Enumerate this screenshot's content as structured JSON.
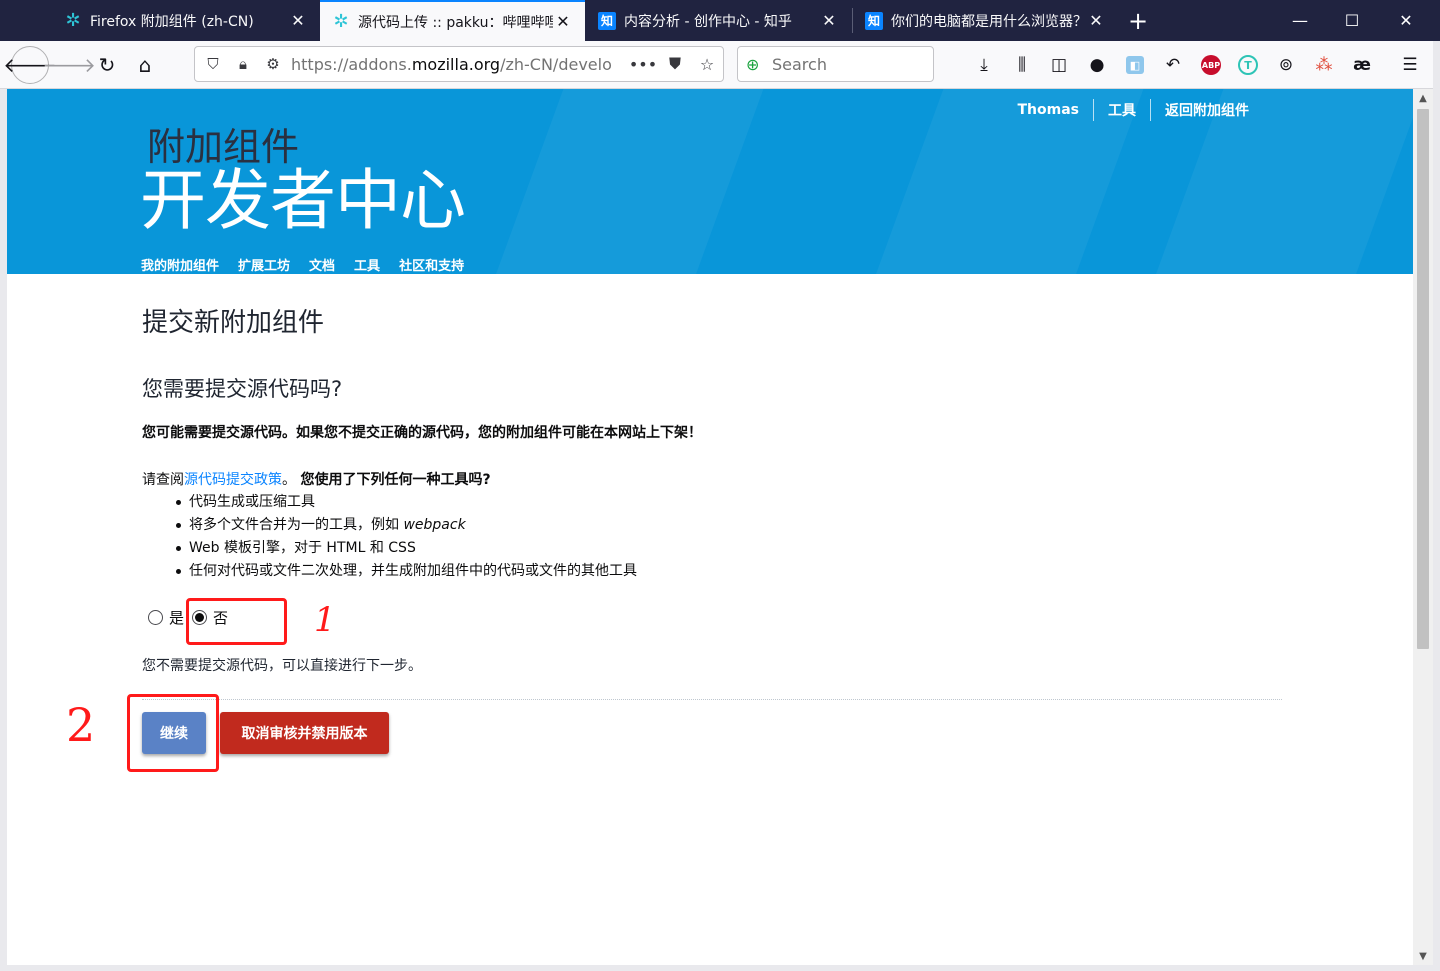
{
  "browser": {
    "tabs": [
      {
        "label": "Firefox 附加组件 (zh-CN)",
        "favicon": "gear-icon"
      },
      {
        "label": "源代码上传 :: pakku：哔哩哔哩",
        "favicon": "gear-icon"
      },
      {
        "label": "内容分析 - 创作中心 - 知乎",
        "favicon": "zhihu-icon"
      },
      {
        "label": "你们的电脑都是用什么浏览器？",
        "favicon": "zhihu-icon"
      }
    ],
    "zhihu_glyph": "知",
    "url_prefix": "https://addons.",
    "url_domain": "mozilla.org",
    "url_path": "/zh-CN/develo",
    "search_placeholder": "Search",
    "ae_glyph": "æ",
    "abp_label": "ABP",
    "teal_glyph": "T"
  },
  "header": {
    "user_link": "Thomas",
    "tools_link": "工具",
    "back_link": "返回附加组件",
    "logo_small": "附加组件",
    "logo_big": "开发者中心",
    "nav": [
      "我的附加组件",
      "扩展工坊",
      "文档",
      "工具",
      "社区和支持"
    ]
  },
  "main": {
    "page_title": "提交新附加组件",
    "question": "您需要提交源代码吗?",
    "warning": "您可能需要提交源代码。如果您不提交正确的源代码，您的附加组件可能在本网站上下架！",
    "policy_prefix": "请查阅",
    "policy_link": "源代码提交政策",
    "policy_suffix": "。",
    "policy_question": "您使用了下列任何一种工具吗?",
    "tools": [
      {
        "text": "代码生成或压缩工具",
        "em": ""
      },
      {
        "text": "将多个文件合并为一的工具，例如 ",
        "em": "webpack"
      },
      {
        "text": "Web 模板引擎，对于 HTML 和 CSS",
        "em": ""
      },
      {
        "text": "任何对代码或文件二次处理，并生成附加组件中的代码或文件的其他工具",
        "em": ""
      }
    ],
    "radio_yes": "是",
    "radio_no": "否",
    "selected": "否",
    "radio_message": "您不需要提交源代码，可以直接进行下一步。",
    "continue_button": "继续",
    "cancel_button": "取消审核并禁用版本"
  },
  "annotations": {
    "mark_1": "1",
    "mark_2": "2",
    "color": "#ff1a1a"
  },
  "colors": {
    "header_blue": "#0996d9",
    "tabstrip": "#202340",
    "continue": "#5a82c6",
    "cancel": "#c12a1e",
    "link": "#0a84ff"
  }
}
